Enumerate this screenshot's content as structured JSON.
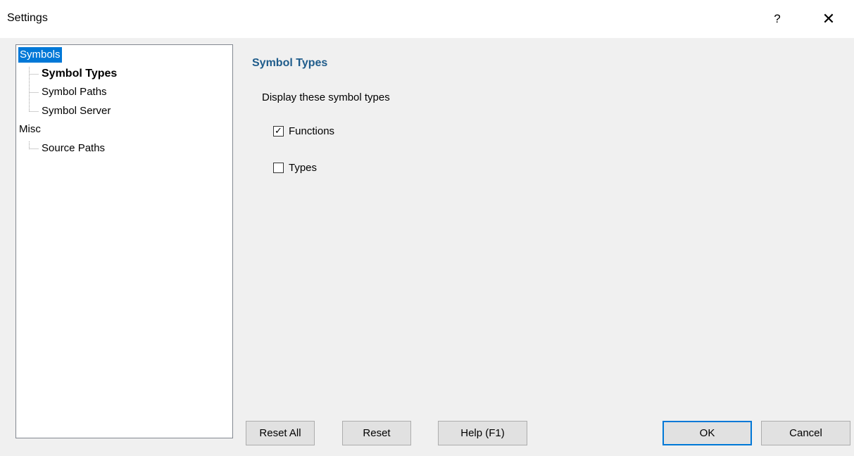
{
  "window": {
    "title": "Settings",
    "help_glyph": "?",
    "close_glyph": "✕"
  },
  "tree": {
    "items": [
      {
        "label": "Symbols",
        "level": 0,
        "selected": true
      },
      {
        "label": "Symbol Types",
        "level": 1,
        "bold": true
      },
      {
        "label": "Symbol Paths",
        "level": 1
      },
      {
        "label": "Symbol Server",
        "level": 1
      },
      {
        "label": "Misc",
        "level": 0
      },
      {
        "label": "Source Paths",
        "level": 1
      }
    ]
  },
  "panel": {
    "title": "Symbol Types",
    "description": "Display these symbol types",
    "options": [
      {
        "label": "Functions",
        "checked": true,
        "check_glyph": "✓"
      },
      {
        "label": "Types",
        "checked": false
      }
    ]
  },
  "buttons": {
    "reset_all": "Reset All",
    "reset": "Reset",
    "help": "Help (F1)",
    "ok": "OK",
    "cancel": "Cancel"
  },
  "colors": {
    "selection": "#0078d7",
    "section_title": "#1f5c8b",
    "window_bg": "#f0f0f0"
  }
}
